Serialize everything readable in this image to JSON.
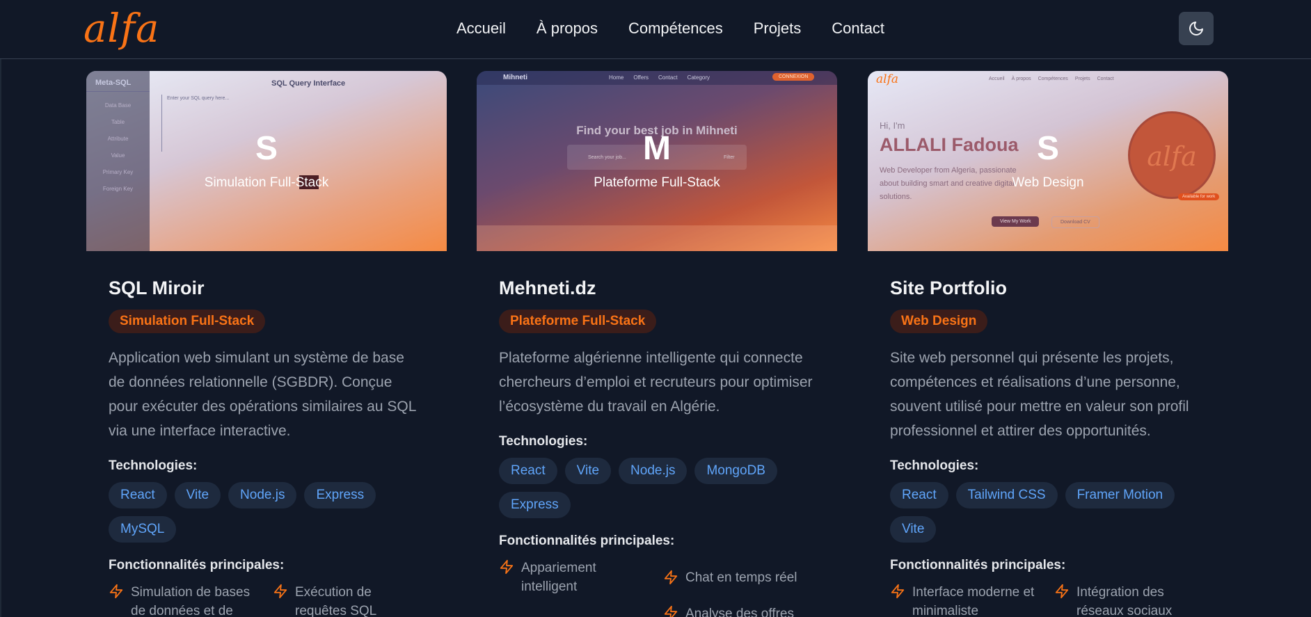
{
  "header": {
    "logo": "alfa",
    "nav": [
      "Accueil",
      "À propos",
      "Compétences",
      "Projets",
      "Contact"
    ],
    "theme_icon": "moon-icon"
  },
  "projects": [
    {
      "thumb_letter": "S",
      "category": "Simulation Full-Stack",
      "title": "SQL Miroir",
      "description": "Application web simulant un système de base de données relationnelle (SGBDR). Conçue pour exécuter des opérations similaires au SQL via une interface interactive.",
      "tech_label": "Technologies:",
      "tech": [
        "React",
        "Vite",
        "Node.js",
        "Express",
        "MySQL"
      ],
      "features_label": "Fonctionnalités principales:",
      "features": [
        "Simulation de bases de données et de tables",
        "Exécution de requêtes SQL"
      ],
      "mock": {
        "brand": "Meta-SQL",
        "header": "SQL Query Interface",
        "placeholder": "Enter your SQL query here...",
        "menu": [
          "Data Base",
          "Table",
          "Attribute",
          "Value",
          "Primary Key",
          "Foreign Key"
        ]
      }
    },
    {
      "thumb_letter": "M",
      "category": "Plateforme Full-Stack",
      "title": "Mehneti.dz",
      "description": "Plateforme algérienne intelligente qui connecte chercheurs d’emploi et recruteurs pour optimiser l’écosystème du travail en Algérie.",
      "tech_label": "Technologies:",
      "tech": [
        "React",
        "Vite",
        "Node.js",
        "MongoDB",
        "Express"
      ],
      "features_label": "Fonctionnalités principales:",
      "features": [
        "Appariement intelligent",
        "Chat en temps réel",
        "Analyse des offres"
      ],
      "mock": {
        "brand": "Mihneti",
        "nav": [
          "Home",
          "Offers",
          "Contact",
          "Category"
        ],
        "button": "CONNEXION",
        "hero": "Find your best job in Mihneti",
        "search": "Search your job...",
        "filter": "Filter"
      }
    },
    {
      "thumb_letter": "S",
      "category": "Web Design",
      "title": "Site Portfolio",
      "description": "Site web personnel qui présente les projets, compétences et réalisations d’une personne, souvent utilisé pour mettre en valeur son profil professionnel et attirer des opportunités.",
      "tech_label": "Technologies:",
      "tech": [
        "React",
        "Tailwind CSS",
        "Framer Motion",
        "Vite"
      ],
      "features_label": "Fonctionnalités principales:",
      "features": [
        "Interface moderne et minimaliste",
        "Intégration des réseaux sociaux"
      ],
      "mock": {
        "logo": "alfa",
        "nav": [
          "Accueil",
          "À propos",
          "Compétences",
          "Projets",
          "Contact"
        ],
        "greeting": "Hi, I'm",
        "name": "ALLALI Fadoua",
        "bio": "Web Developer from Algeria, passionate about building smart and creative digital solutions.",
        "btn1": "View My Work",
        "btn2": "Download CV",
        "chip": "Available for work"
      }
    }
  ]
}
